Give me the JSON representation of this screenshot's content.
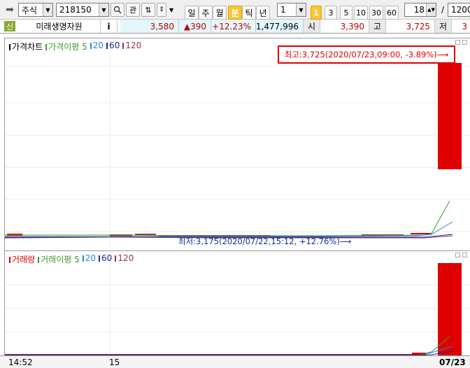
{
  "toolbar": {
    "market": "주식",
    "code": "218150",
    "watch_label": "관",
    "periods": [
      "일",
      "주",
      "월",
      "분",
      "틱",
      "년"
    ],
    "active_period": "분",
    "interval_value": "1",
    "intervals": [
      "1",
      "3",
      "5",
      "10",
      "30",
      "60"
    ],
    "active_interval": "1",
    "count_value": "18",
    "slash": "/",
    "total_value": "1200"
  },
  "quote": {
    "badge": "신",
    "name": "미래생명자원",
    "info_label": "i",
    "price": "3,580",
    "change": "▲390",
    "change_pct": "+12.23%",
    "volume": "1,477,996",
    "open_label": "시",
    "open": "3,390",
    "high_label": "고",
    "high": "3,725",
    "low_label": "저",
    "low": "3"
  },
  "price_panel": {
    "legend": [
      {
        "text": "가격차트",
        "color": "#000000"
      },
      {
        "text": "가격이평 5",
        "color": "#3c9a2c"
      },
      {
        "text": "20",
        "color": "#1e88d8"
      },
      {
        "text": "60",
        "color": "#1a2a9a"
      },
      {
        "text": "120",
        "color": "#a0304a"
      }
    ],
    "high_annotation": "최고:3,725(2020/07/23,09:00, -3.89%)⟶",
    "low_annotation": "최저:3,175(2020/07/22,15:12, +12.76%)⟶"
  },
  "volume_panel": {
    "legend": [
      {
        "text": "거래량",
        "color": "#e00000"
      },
      {
        "text": "거래이평 5",
        "color": "#3c9a2c"
      },
      {
        "text": "20",
        "color": "#1e88d8"
      },
      {
        "text": "60",
        "color": "#1a2a9a"
      },
      {
        "text": "120",
        "color": "#a0304a"
      }
    ]
  },
  "xaxis": {
    "labels": [
      "14:52",
      "15",
      "07/23"
    ]
  },
  "colors": {
    "up": "#e00000",
    "annotation_border": "#e00000",
    "quote_bg": "#e3f6fb"
  }
}
